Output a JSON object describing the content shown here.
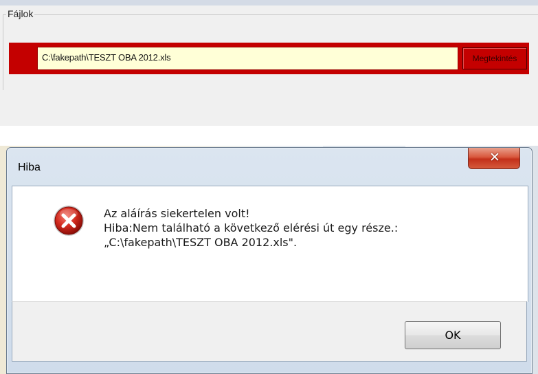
{
  "file_panel": {
    "legend": "Fájlok",
    "file_path": "C:\\fakepath\\TESZT OBA 2012.xls",
    "view_button": "Megtekintés"
  },
  "dialog": {
    "title": "Hiba",
    "close_label": "X",
    "message_lines": [
      "Az aláírás siekertelen volt!",
      "Hiba:Nem található a következő elérési út egy része.:",
      "„C:\\fakepath\\TESZT OBA 2012.xls\"."
    ],
    "ok_button": "OK",
    "icon": "error-icon"
  },
  "colors": {
    "panel_red": "#c40000",
    "input_bg": "#ffffd7",
    "close_red": "#d9583d"
  }
}
